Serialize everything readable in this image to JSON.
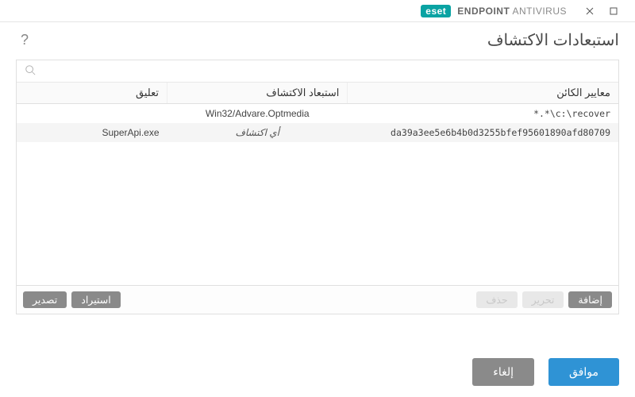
{
  "brand": {
    "badge": "eset",
    "product_strong": "ENDPOINT",
    "product_rest": "ANTIVIRUS"
  },
  "header": {
    "title": "استبعادات الاكتشاف"
  },
  "search": {
    "placeholder": ""
  },
  "columns": {
    "object": "معايير الكائن",
    "detection": "استبعاد الاكتشاف",
    "comment": "تعليق"
  },
  "rows": [
    {
      "object": "*.*\\c:\\recover",
      "detection": "Win32/Advare.Optmedia",
      "detection_is_any": false,
      "comment": ""
    },
    {
      "object": "da39a3ee5e6b4b0d3255bfef95601890afd80709",
      "detection": "أي اكتشاف",
      "detection_is_any": true,
      "comment": "SuperApi.exe"
    }
  ],
  "toolbar": {
    "add": "إضافة",
    "edit": "تحرير",
    "delete": "حذف",
    "import": "استيراد",
    "export": "تصدير"
  },
  "footer": {
    "ok": "موافق",
    "cancel": "إلغاء"
  }
}
